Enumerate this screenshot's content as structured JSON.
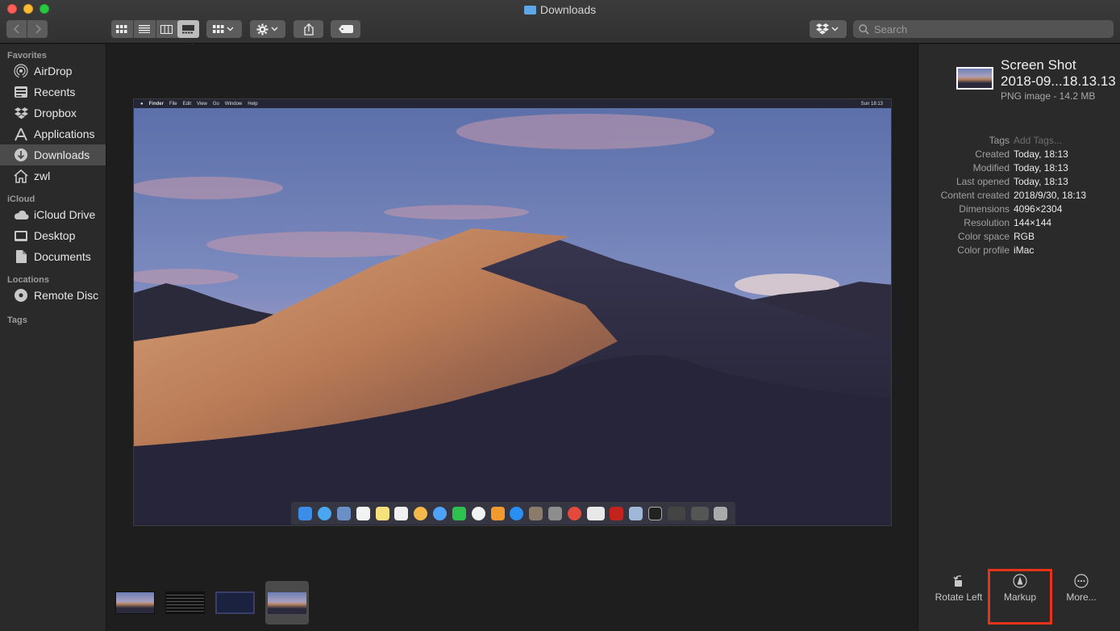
{
  "window": {
    "title": "Downloads"
  },
  "search": {
    "placeholder": "Search"
  },
  "sidebar": {
    "favorites_header": "Favorites",
    "favorites": [
      {
        "label": "AirDrop",
        "icon": "airdrop-icon"
      },
      {
        "label": "Recents",
        "icon": "clock-icon"
      },
      {
        "label": "Dropbox",
        "icon": "dropbox-icon"
      },
      {
        "label": "Applications",
        "icon": "applications-icon"
      },
      {
        "label": "Downloads",
        "icon": "downloads-icon"
      },
      {
        "label": "zwl",
        "icon": "home-icon"
      }
    ],
    "icloud_header": "iCloud",
    "icloud": [
      {
        "label": "iCloud Drive",
        "icon": "cloud-icon"
      },
      {
        "label": "Desktop",
        "icon": "desktop-icon"
      },
      {
        "label": "Documents",
        "icon": "document-icon"
      }
    ],
    "locations_header": "Locations",
    "locations": [
      {
        "label": "Remote Disc",
        "icon": "disc-icon"
      }
    ],
    "tags_header": "Tags"
  },
  "preview": {
    "menubar": {
      "items": [
        "Finder",
        "File",
        "Edit",
        "View",
        "Go",
        "Window",
        "Help"
      ],
      "clock": "Sun 18:13"
    }
  },
  "inspector": {
    "file_name_line1": "Screen Shot",
    "file_name_line2": "2018-09...18.13.13",
    "file_kind": "PNG image - 14.2 MB",
    "metadata": [
      {
        "key": "Tags",
        "value": "Add Tags..."
      },
      {
        "key": "Created",
        "value": "Today, 18:13"
      },
      {
        "key": "Modified",
        "value": "Today, 18:13"
      },
      {
        "key": "Last opened",
        "value": "Today, 18:13"
      },
      {
        "key": "Content created",
        "value": "2018/9/30, 18:13"
      },
      {
        "key": "Dimensions",
        "value": "4096×2304"
      },
      {
        "key": "Resolution",
        "value": "144×144"
      },
      {
        "key": "Color space",
        "value": "RGB"
      },
      {
        "key": "Color profile",
        "value": "iMac"
      }
    ],
    "actions": {
      "rotate_left": "Rotate Left",
      "markup": "Markup",
      "more": "More..."
    }
  },
  "colors": {
    "annotation": "#e8331b",
    "selection": "#4c4b4c"
  }
}
